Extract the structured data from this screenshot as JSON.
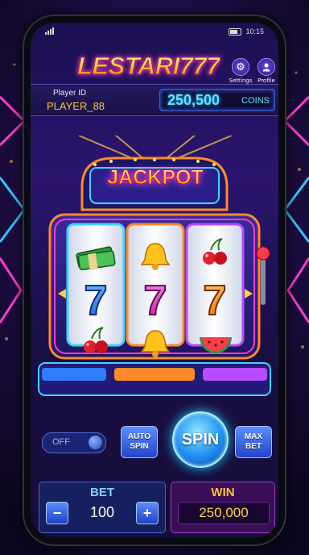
{
  "status_bar": {
    "time": "10:15"
  },
  "header": {
    "logo_text": "LESTARI777",
    "settings_label": "Settings",
    "settings_icon": "gear-icon",
    "profile_label": "Profile",
    "profile_icon": "person-icon"
  },
  "player": {
    "id_label": "Player ID",
    "id_value": "PLAYER_88"
  },
  "balance": {
    "amount": "250,500",
    "unit": "COINS"
  },
  "machine": {
    "banner": "JACKPOT",
    "reels": [
      [
        "cash-stack",
        "seven",
        "cherries"
      ],
      [
        "bell",
        "seven",
        "bell"
      ],
      [
        "cherries",
        "seven",
        "watermelon"
      ]
    ]
  },
  "controls": {
    "autoplay_toggle_label": "OFF",
    "auto_spin_line1": "AUTO",
    "auto_spin_line2": "SPIN",
    "spin_label": "SPIN",
    "max_bet_line1": "MAX",
    "max_bet_line2": "BET"
  },
  "bet": {
    "label": "BET",
    "value": "100",
    "minus": "−",
    "plus": "+"
  },
  "win": {
    "label": "WIN",
    "value": "250,000"
  },
  "colors": {
    "accent_cyan": "#5fe4ff",
    "gold": "#ffc23a",
    "neon_pink": "#ff36d0",
    "neon_blue": "#2f6cff"
  }
}
